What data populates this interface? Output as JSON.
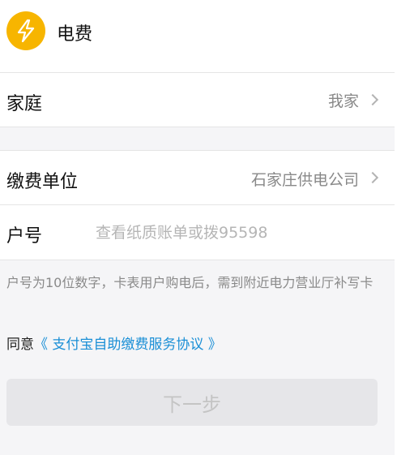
{
  "header": {
    "icon": "lightning-bolt-icon",
    "icon_color": "#f7b500",
    "title": "电费"
  },
  "family_row": {
    "label": "家庭",
    "value": "我家",
    "icon": "chevron-right-icon"
  },
  "unit_row": {
    "label": "缴费单位",
    "value": "石家庄供电公司",
    "icon": "chevron-right-icon"
  },
  "account_row": {
    "label": "户号",
    "value": "",
    "placeholder": "查看纸质账单或拨95598"
  },
  "hint": "户号为10位数字，卡表用户购电后，需到附近电力营业厅补写卡",
  "agreement": {
    "prefix": "同意",
    "link": "《 支付宝自助缴费服务协议 》",
    "link_color": "#1a8fd6"
  },
  "next_button": {
    "label": "下一步",
    "enabled": false
  }
}
